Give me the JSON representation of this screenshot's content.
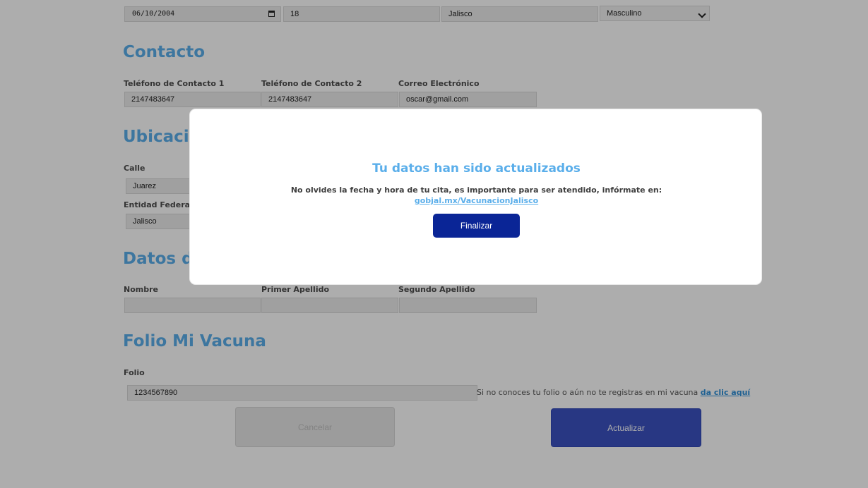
{
  "birth": {
    "date_value": "06/10/2004",
    "age_value": "18",
    "state_value": "Jalisco",
    "sex_value": "Masculino"
  },
  "contact": {
    "title": "Contacto",
    "phone1_label": "Teléfono de Contacto 1",
    "phone1_value": "2147483647",
    "phone2_label": "Teléfono de Contacto 2",
    "phone2_value": "2147483647",
    "email_label": "Correo Electrónico",
    "email_value": "oscar@gmail.com"
  },
  "location": {
    "title": "Ubicación",
    "street_label": "Calle",
    "street_value": "Juarez",
    "state_label": "Entidad Federativa",
    "state_value": "Jalisco"
  },
  "data_section": {
    "title": "Datos de",
    "name_label": "Nombre",
    "name_value": "",
    "first_surname_label": "Primer Apellido",
    "first_surname_value": "",
    "second_surname_label": "Segundo Apellido",
    "second_surname_value": ""
  },
  "folio": {
    "title": "Folio Mi Vacuna",
    "label": "Folio",
    "value": "1234567890",
    "hint_text": "Si no conoces tu folio o aún no te registras en mi vacuna ",
    "hint_link": "da clic aquí"
  },
  "actions": {
    "cancel_label": "Cancelar",
    "update_label": "Actualizar"
  },
  "modal": {
    "title": "Tu datos han sido actualizados",
    "message": "No olvides la fecha y hora de tu cita, es importante para ser atendido, infórmate en:",
    "link": "gobjal.mx/VacunacionJalisco",
    "button_label": "Finalizar"
  },
  "colors": {
    "accent": "#5aaeea",
    "primary_button": "#0a2596",
    "update_button": "#3b52c2"
  }
}
